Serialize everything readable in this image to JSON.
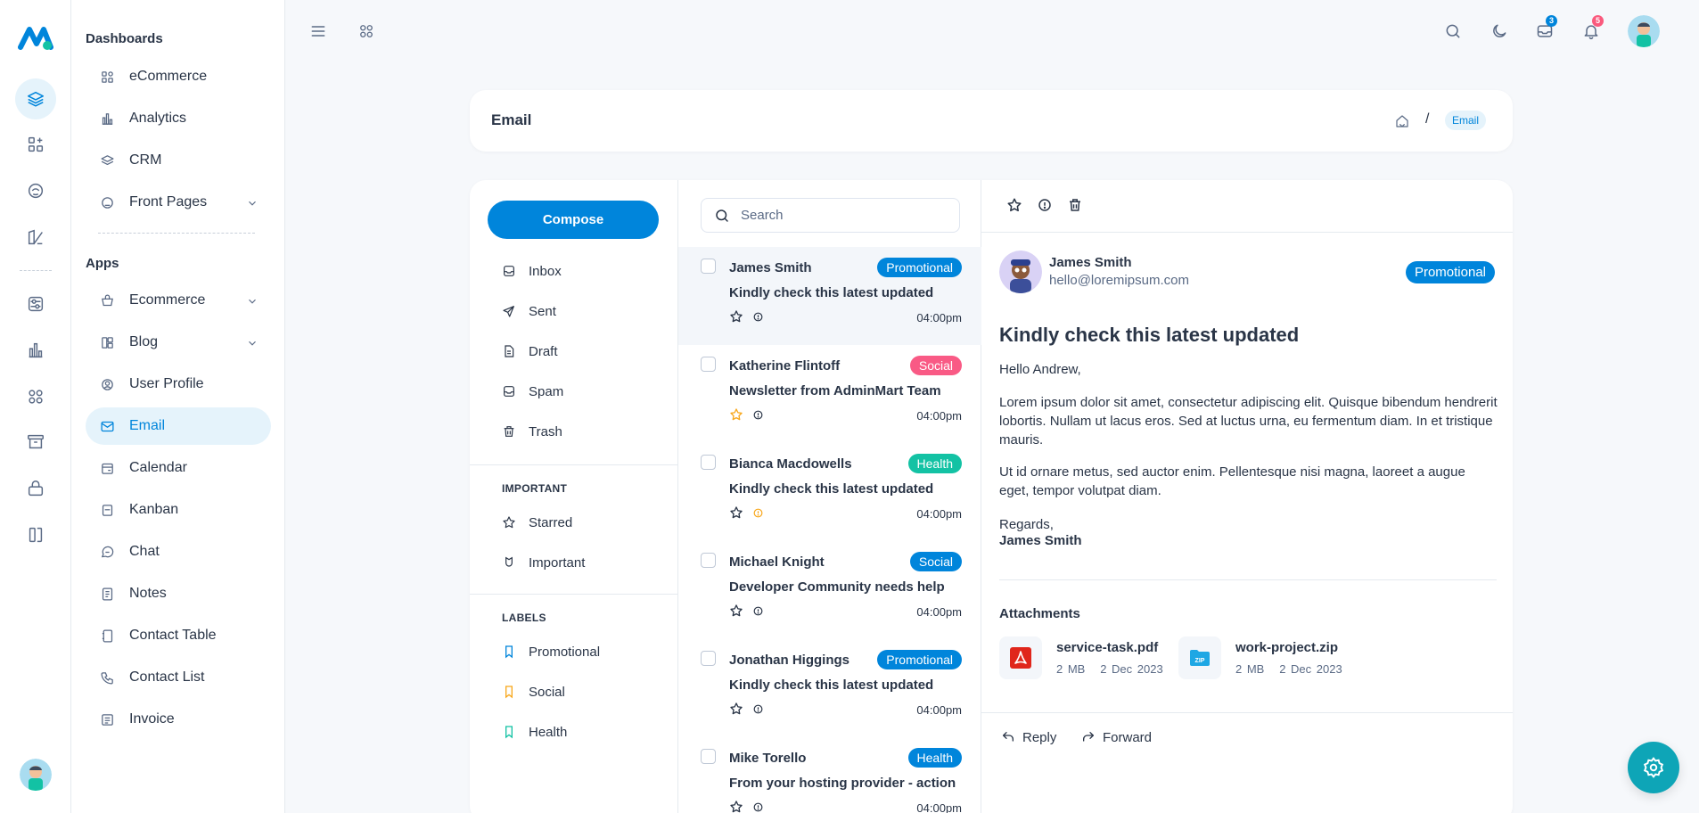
{
  "sidebar": {
    "section_dashboards": "Dashboards",
    "section_apps": "Apps",
    "items": [
      {
        "label": "eCommerce"
      },
      {
        "label": "Analytics"
      },
      {
        "label": "CRM"
      },
      {
        "label": "Front Pages"
      },
      {
        "label": "Ecommerce"
      },
      {
        "label": "Blog"
      },
      {
        "label": "User Profile"
      },
      {
        "label": "Email"
      },
      {
        "label": "Calendar"
      },
      {
        "label": "Kanban"
      },
      {
        "label": "Chat"
      },
      {
        "label": "Notes"
      },
      {
        "label": "Contact Table"
      },
      {
        "label": "Contact List"
      },
      {
        "label": "Invoice"
      }
    ],
    "active_item": "Email"
  },
  "topbar": {
    "messages_count": "3",
    "notifications_count": "5"
  },
  "page_header": {
    "title": "Email",
    "breadcrumb_separator": "/",
    "breadcrumb_current": "Email"
  },
  "folders": {
    "compose_label": "Compose",
    "items": [
      {
        "label": "Inbox",
        "icon": "inbox-icon"
      },
      {
        "label": "Sent",
        "icon": "send-icon"
      },
      {
        "label": "Draft",
        "icon": "file-icon"
      },
      {
        "label": "Spam",
        "icon": "spam-icon"
      },
      {
        "label": "Trash",
        "icon": "trash-icon"
      }
    ],
    "important_heading": "IMPORTANT",
    "important_items": [
      {
        "label": "Starred"
      },
      {
        "label": "Important"
      }
    ],
    "labels_heading": "LABELS",
    "labels": [
      {
        "label": "Promotional",
        "color": "#0085db"
      },
      {
        "label": "Social",
        "color": "#f8a71b"
      },
      {
        "label": "Health",
        "color": "#13c2a4"
      }
    ]
  },
  "search": {
    "placeholder": "Search"
  },
  "mails": [
    {
      "name": "James Smith",
      "subject": "Kindly check this latest updated",
      "tag": "Promotional",
      "tag_color": "#0085db",
      "time": "04:00pm",
      "starred": false,
      "important": false
    },
    {
      "name": "Katherine Flintoff",
      "subject": "Newsletter from AdminMart Team",
      "tag": "Social",
      "tag_color": "#f95a85",
      "time": "04:00pm",
      "starred": true,
      "important": false
    },
    {
      "name": "Bianca Macdowells",
      "subject": "Kindly check this latest updated",
      "tag": "Health",
      "tag_color": "#13c2a4",
      "time": "04:00pm",
      "starred": false,
      "important": true
    },
    {
      "name": "Michael Knight",
      "subject": "Developer Community needs help",
      "tag": "Social",
      "tag_color": "#0085db",
      "time": "04:00pm",
      "starred": false,
      "important": false
    },
    {
      "name": "Jonathan Higgings",
      "subject": "Kindly check this latest updated",
      "tag": "Promotional",
      "tag_color": "#0085db",
      "time": "04:00pm",
      "starred": false,
      "important": false
    },
    {
      "name": "Mike Torello",
      "subject": "From your hosting provider - action",
      "tag": "Health",
      "tag_color": "#0085db",
      "time": "04:00pm",
      "starred": false,
      "important": false
    }
  ],
  "reader": {
    "sender_name": "James Smith",
    "sender_email": "hello@loremipsum.com",
    "tag": "Promotional",
    "subject": "Kindly check this latest updated",
    "greeting": "Hello Andrew,",
    "paragraph1": "Lorem ipsum dolor sit amet, consectetur adipiscing elit. Quisque bibendum hendrerit lobortis. Nullam ut lacus eros. Sed at luctus urna, eu fermentum diam. In et tristique mauris.",
    "paragraph2": "Ut id ornare metus, sed auctor enim. Pellentesque nisi magna, laoreet a augue eget, tempor volutpat diam.",
    "regards": "Regards,",
    "signature": "James Smith",
    "attachments_heading": "Attachments",
    "attachments": [
      {
        "name": "service-task.pdf",
        "size": "2 MB",
        "date": "2 Dec 2023",
        "icon": "pdf-icon"
      },
      {
        "name": "work-project.zip",
        "size": "2 MB",
        "date": "2 Dec 2023",
        "icon": "zip-icon"
      }
    ],
    "reply_label": "Reply",
    "forward_label": "Forward"
  },
  "colors": {
    "primary": "#0085db",
    "fab": "#0ea5b7",
    "badge_red": "#fa5a7d"
  }
}
